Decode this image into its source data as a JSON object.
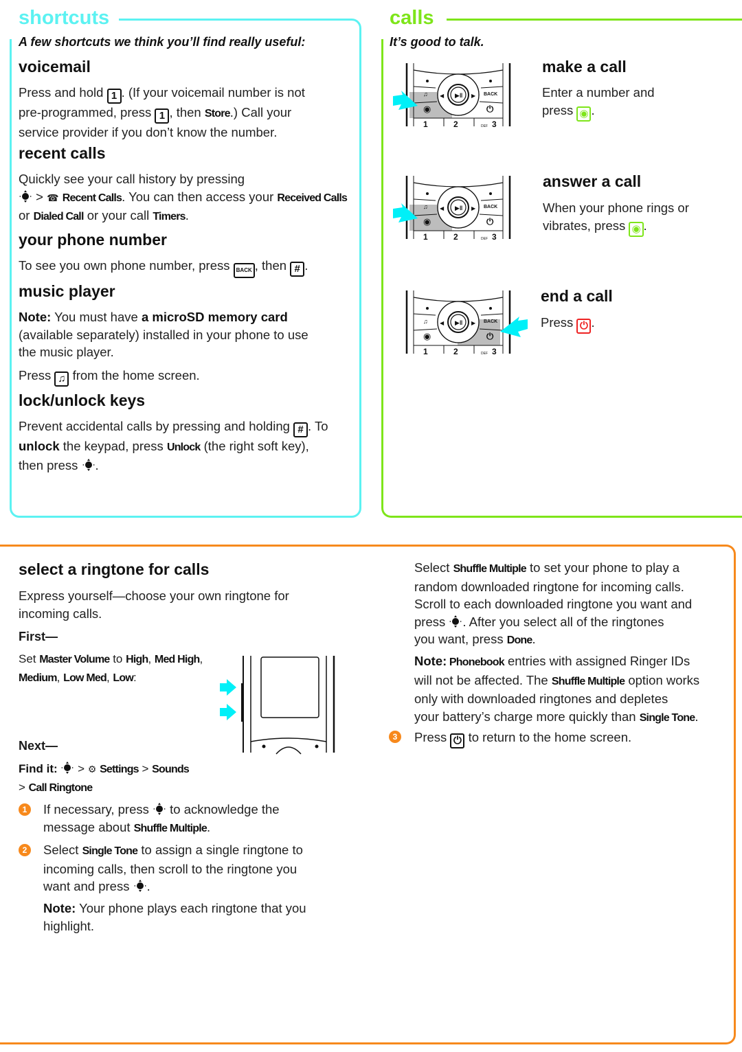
{
  "shortcuts": {
    "title": "shortcuts",
    "accent": "#5cf2f2",
    "tagline": "A few shortcuts we think you’ll find really useful:",
    "voicemail": {
      "heading": "voicemail",
      "t1": "Press and hold ",
      "key1": "1",
      "t2": ". (If your voicemail number is not",
      "t3": "pre-programmed, press ",
      "key2": "1",
      "t4": ", then ",
      "m1": "Store",
      "t5": ".) Call your",
      "t6": "service provider if you don’t know the number."
    },
    "recent_calls": {
      "heading": "recent calls",
      "t1": "Quickly see your call history by pressing",
      "sep": " > ",
      "m1": "Recent Calls",
      "t2": ". You can then access your ",
      "m2": "Received Calls",
      "t3": "or ",
      "m3": "Dialed Call",
      "t4": " or your call ",
      "m4": "Timers",
      "t5": "."
    },
    "phone_number": {
      "heading": "your phone number",
      "t1": "To see you own phone number, press ",
      "key1": "BACK",
      "t2": ", then ",
      "key2": "#",
      "t3": "."
    },
    "music_player": {
      "heading": "music player",
      "note_label": "Note:",
      "t1": " You must have ",
      "bold1": "a microSD memory card",
      "t2": "(available separately) installed in your phone to use",
      "t3": "the music player.",
      "t4": "Press ",
      "key1": "♫",
      "t5": " from the home screen."
    },
    "lock_keys": {
      "heading": "lock/unlock keys",
      "t1": "Prevent accidental calls by pressing and holding ",
      "key1": "#",
      "t2": ". To",
      "bold1": "unlock",
      "t3": " the keypad, press ",
      "m1": "Unlock",
      "t4": " (the right soft key),",
      "t5": "then press ",
      "t6": "."
    }
  },
  "calls": {
    "title": "calls",
    "accent": "#7ee51a",
    "tagline": "It’s good to talk.",
    "make": {
      "heading": "make a call",
      "t1": "Enter a number and",
      "t2": "press ",
      "t3": "."
    },
    "answer": {
      "heading": "answer a call",
      "t1": "When your phone rings or",
      "t2": "vibrates, press ",
      "t3": "."
    },
    "end": {
      "heading": "end a call",
      "t1": "Press ",
      "t2": "."
    },
    "keypad_labels": {
      "back": "BACK",
      "k1": "1",
      "k2": "2",
      "k3": "3",
      "def": "DEF"
    }
  },
  "ringtone": {
    "accent": "#f7891c",
    "heading": "select a ringtone for calls",
    "intro1": "Express yourself—choose your own ringtone for",
    "intro2": "incoming calls.",
    "first_label": "First—",
    "set1": "Set ",
    "m_master": "Master Volume",
    "to": " to ",
    "m_high": "High",
    "c1": ", ",
    "m_medhigh": "Med High",
    "c2": ",",
    "m_medium": "Medium",
    "c3": ", ",
    "m_lowmed": "Low Med",
    "c4": ", ",
    "m_low": "Low",
    "colon": ":",
    "next_label": "Next—",
    "findit_label": "Find it:",
    "gt": " > ",
    "m_settings": "Settings",
    "m_sounds": "Sounds",
    "gt2": "> ",
    "m_callringtone": "Call Ringtone",
    "steps": [
      {
        "num": "1",
        "t1": "If necessary, press ",
        "t2": " to acknowledge the",
        "t3": "message about ",
        "m1": "Shuffle Multiple",
        "t4": "."
      },
      {
        "num": "2",
        "t1": "Select ",
        "m1": "Single Tone",
        "t2": " to assign a single ringtone to",
        "t3": "incoming calls, then scroll to the ringtone you",
        "t4": "want and press ",
        "t5": "."
      },
      {
        "num": "3",
        "t1": "Press ",
        "t2": " to return to the home screen."
      }
    ],
    "note1_label": "Note:",
    "note1_t1": " Your phone plays each ringtone that you",
    "note1_t2": "highlight.",
    "right": {
      "l1a": "Select ",
      "l1m": "Shuffle Multiple",
      "l1b": " to set your phone to play a",
      "l2": "random downloaded ringtone for incoming calls.",
      "l3": "Scroll to each downloaded ringtone you want and",
      "l4a": "press ",
      "l4b": ". After you select all of the ringtones",
      "l5a": "you want, press ",
      "l5m": "Done",
      "l5b": ".",
      "note_label": "Note:",
      "n1m": " Phonebook",
      "n1b": " entries with assigned Ringer IDs",
      "n2a": "will not be affected. The ",
      "n2m": "Shuffle Multiple",
      "n2b": " option works",
      "n3": "only with downloaded ringtones and depletes",
      "n4a": "your battery’s charge more quickly than ",
      "n4m": "Single Tone",
      "n4b": "."
    }
  }
}
